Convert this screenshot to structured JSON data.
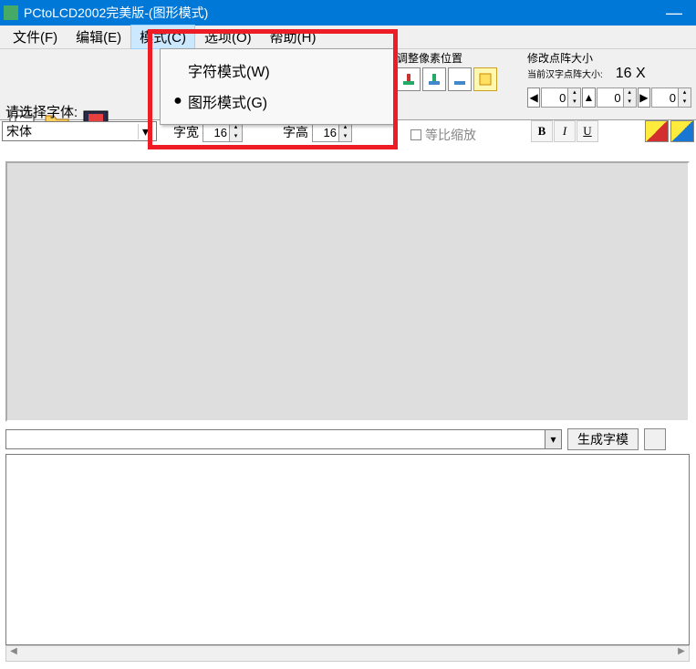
{
  "title": "PCtoLCD2002完美版-(图形模式)",
  "menu": {
    "file": "文件(F)",
    "edit": "编辑(E)",
    "mode": "模式(C)",
    "options": "选项(O)",
    "help": "帮助(H)"
  },
  "mode_menu": {
    "char_mode": "字符模式(W)",
    "graphic_mode": "图形模式(G)"
  },
  "labels": {
    "select_font": "请选择字体:",
    "font_name": "宋体",
    "char_width": "字宽",
    "char_height": "字高",
    "char_width_val": "16",
    "char_height_val": "16",
    "pixel_adjust": "调整像素位置",
    "modify_matrix": "修改点阵大小",
    "current_matrix": "当前汉字点阵大小:",
    "matrix_val": "16 X",
    "proportional": "等比缩放",
    "generate": "生成字模",
    "spin1": "0",
    "spin2": "0",
    "spin3": "0"
  },
  "style": {
    "b": "B",
    "i": "I",
    "u": "U"
  }
}
